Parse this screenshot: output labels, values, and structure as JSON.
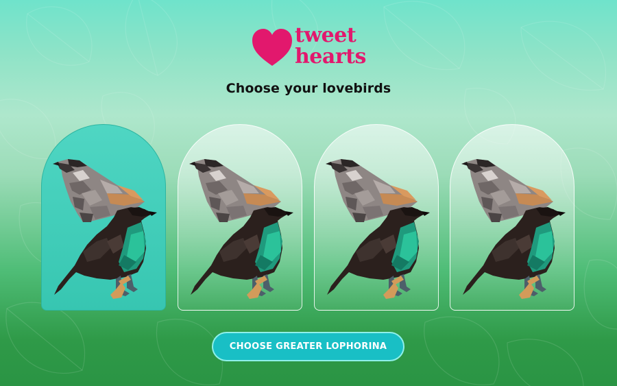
{
  "brand": {
    "line1": "tweet",
    "line2": "hearts",
    "color": "#e2186d"
  },
  "subtitle": "Choose your lovebirds",
  "cards": [
    {
      "selected": true,
      "icon": "bird-pair-illustration"
    },
    {
      "selected": false,
      "icon": "bird-pair-illustration"
    },
    {
      "selected": false,
      "icon": "bird-pair-illustration"
    },
    {
      "selected": false,
      "icon": "bird-pair-illustration"
    }
  ],
  "cta": {
    "label": "CHOOSE GREATER LOPHORINA"
  },
  "colors": {
    "selected_card": "#37c6b1",
    "button": "#19bfc5",
    "background_top": "#6fe3cb",
    "background_bottom": "#2a9444"
  }
}
